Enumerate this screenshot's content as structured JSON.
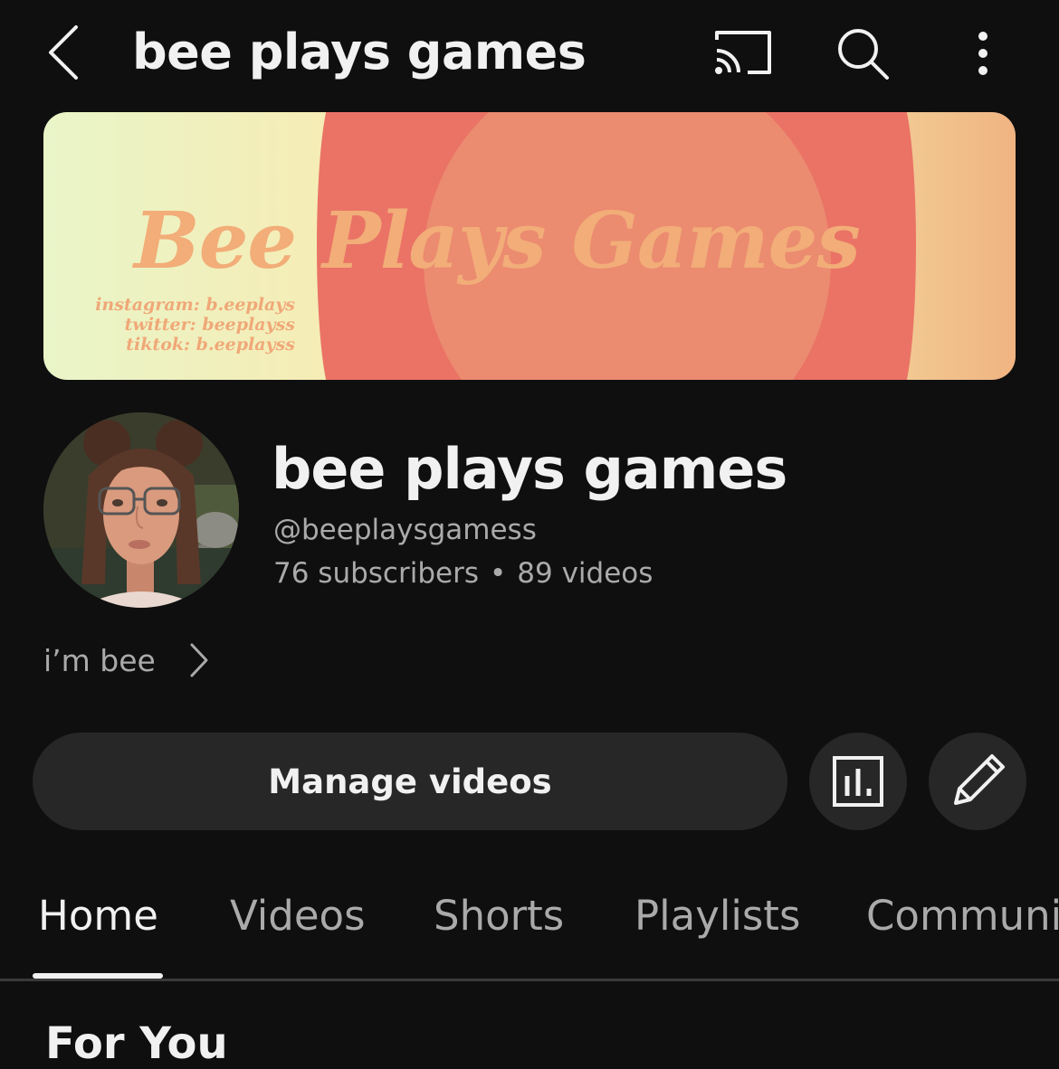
{
  "header": {
    "title": "bee plays games",
    "back_icon": "chevron-left-icon",
    "cast_icon": "cast-icon",
    "search_icon": "search-icon",
    "more_icon": "more-vertical-icon"
  },
  "banner": {
    "title": "Bee Plays Games",
    "socials": [
      "instagram: b.eeplays",
      "twitter: beeplayss",
      "tiktok: b.eeplayss"
    ]
  },
  "channel": {
    "name": "bee plays games",
    "handle": "@beeplaysgamess",
    "subscribers": "76 subscribers",
    "separator": "•",
    "videos": "89 videos",
    "bio": "i’m bee"
  },
  "actions": {
    "manage_label": "Manage videos",
    "analytics_icon": "analytics-icon",
    "edit_icon": "pencil-icon"
  },
  "tabs": [
    {
      "label": "Home",
      "active": true
    },
    {
      "label": "Videos",
      "active": false
    },
    {
      "label": "Shorts",
      "active": false
    },
    {
      "label": "Playlists",
      "active": false
    },
    {
      "label": "Communi",
      "active": false
    }
  ],
  "section": {
    "title": "For You"
  },
  "colors": {
    "background": "#0f0f0f",
    "button": "#272727",
    "text_primary": "#f1f1f1",
    "text_secondary": "#aaaaaa",
    "banner_coral": "#ea7366",
    "banner_circle": "#eb8b70"
  }
}
